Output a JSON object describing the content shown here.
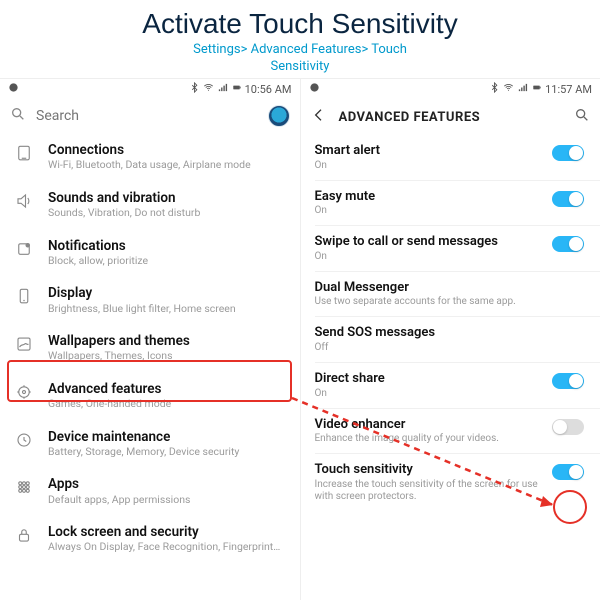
{
  "header": {
    "title": "Activate Touch Sensitivity",
    "breadcrumb_line1": "Settings> Advanced Features> Touch",
    "breadcrumb_line2": "Sensitivity"
  },
  "left": {
    "status_time": "10:56 AM",
    "search_placeholder": "Search",
    "items": [
      {
        "label": "Connections",
        "sub": "Wi-Fi, Bluetooth, Data usage, Airplane mode"
      },
      {
        "label": "Sounds and vibration",
        "sub": "Sounds, Vibration, Do not disturb"
      },
      {
        "label": "Notifications",
        "sub": "Block, allow, prioritize"
      },
      {
        "label": "Display",
        "sub": "Brightness, Blue light filter, Home screen"
      },
      {
        "label": "Wallpapers and themes",
        "sub": "Wallpapers, Themes, Icons"
      },
      {
        "label": "Advanced features",
        "sub": "Games, One-handed mode"
      },
      {
        "label": "Device maintenance",
        "sub": "Battery, Storage, Memory, Device security"
      },
      {
        "label": "Apps",
        "sub": "Default apps, App permissions"
      },
      {
        "label": "Lock screen and security",
        "sub": "Always On Display, Face Recognition, Fingerprints, Iris"
      }
    ]
  },
  "right": {
    "status_time": "11:57 AM",
    "title": "ADVANCED FEATURES",
    "items": [
      {
        "label": "Smart alert",
        "sub": "On",
        "toggle": true
      },
      {
        "label": "Easy mute",
        "sub": "On",
        "toggle": true
      },
      {
        "label": "Swipe to call or send messages",
        "sub": "On",
        "toggle": true
      },
      {
        "label": "Dual Messenger",
        "sub": "Use two separate accounts for the same app."
      },
      {
        "label": "Send SOS messages",
        "sub": "Off"
      },
      {
        "label": "Direct share",
        "sub": "On",
        "toggle": true
      },
      {
        "label": "Video enhancer",
        "sub": "Enhance the image quality of your videos.",
        "toggle": false
      },
      {
        "label": "Touch sensitivity",
        "sub": "Increase the touch sensitivity of the screen for use with screen protectors.",
        "toggle": true
      }
    ]
  }
}
